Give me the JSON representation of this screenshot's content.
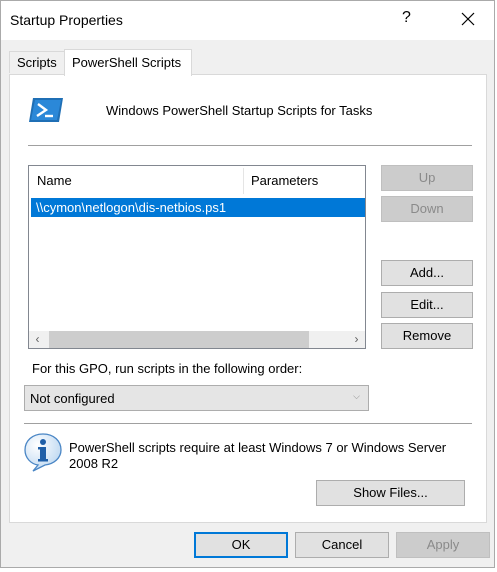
{
  "window": {
    "title": "Startup Properties",
    "help_label": "?",
    "close_icon": "close-icon"
  },
  "tabs": [
    {
      "label": "Scripts",
      "active": false
    },
    {
      "label": "PowerShell Scripts",
      "active": true
    }
  ],
  "header": {
    "icon": "powershell-icon",
    "text": "Windows PowerShell Startup Scripts for Tasks"
  },
  "list": {
    "columns": [
      "Name",
      "Parameters"
    ],
    "rows": [
      {
        "name": "\\\\cymon\\netlogon\\dis-netbios.ps1",
        "parameters": "",
        "selected": true
      }
    ]
  },
  "buttons": {
    "up": "Up",
    "down": "Down",
    "add": "Add...",
    "edit": "Edit...",
    "remove": "Remove",
    "show_files": "Show Files...",
    "ok": "OK",
    "cancel": "Cancel",
    "apply": "Apply"
  },
  "order": {
    "label": "For this GPO, run scripts in the following order:",
    "selected": "Not configured"
  },
  "info": {
    "icon": "info-icon",
    "text": "PowerShell scripts require at least Windows 7 or Windows Server 2008 R2"
  },
  "colors": {
    "selection": "#0078d7",
    "dialog_bg": "#f0f0f0",
    "panel_bg": "#ffffff"
  }
}
